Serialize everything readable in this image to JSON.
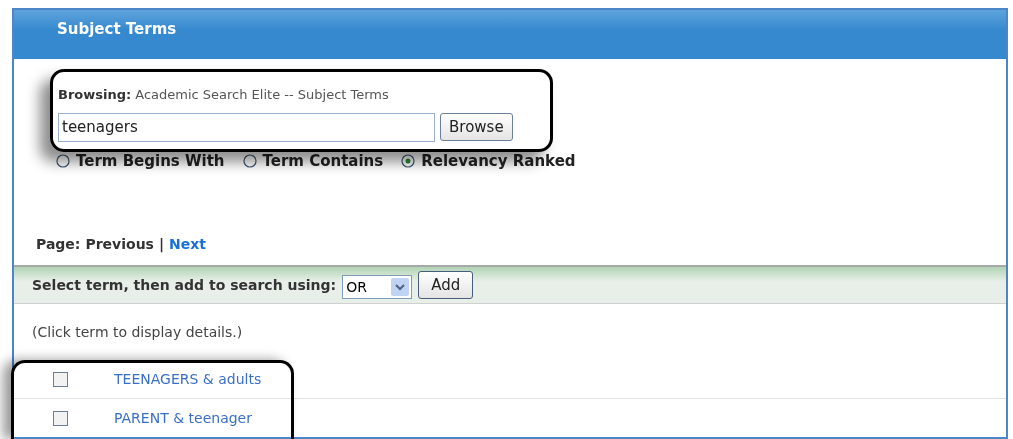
{
  "panel": {
    "title": "Subject Terms"
  },
  "browse": {
    "label": "Browsing:",
    "database": "Academic Search Elite -- Subject Terms",
    "value": "teenagers",
    "button": "Browse"
  },
  "modes": [
    {
      "label": "Term Begins With",
      "selected": false
    },
    {
      "label": "Term Contains",
      "selected": false
    },
    {
      "label": "Relevancy Ranked",
      "selected": true
    }
  ],
  "paging": {
    "label": "Page:",
    "separator": "|",
    "links": [
      {
        "label": "Previous",
        "disabled": true
      },
      {
        "label": "Next",
        "disabled": false
      }
    ]
  },
  "add_bar": {
    "label": "Select term, then add to search using:",
    "operator": "OR",
    "button": "Add"
  },
  "hint": "(Click term to display details.)",
  "terms": [
    {
      "label": "TEENAGERS & adults",
      "checked": false
    },
    {
      "label": "PARENT & teenager",
      "checked": false
    }
  ]
}
